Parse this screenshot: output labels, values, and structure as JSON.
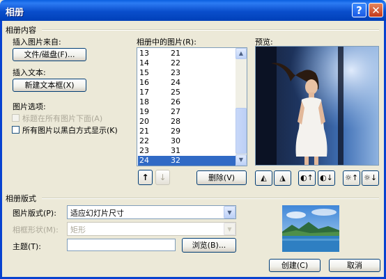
{
  "window": {
    "title": "相册",
    "help_glyph": "?",
    "close_glyph": "✕"
  },
  "album_content": {
    "group_label": "相册内容",
    "insert_from_label": "插入图片来自:",
    "file_disk_button": "文件/磁盘(F)...",
    "insert_text_label": "插入文本:",
    "new_textbox_button": "新建文本框(X)",
    "picture_options_label": "图片选项:",
    "caption_below_label": "标题在所有图片下面(A)",
    "caption_below_checked": false,
    "caption_below_enabled": false,
    "all_bw_label": "所有图片以黑白方式显示(K)",
    "all_bw_checked": false,
    "all_bw_enabled": true
  },
  "pictures_list": {
    "label": "相册中的图片(R):",
    "rows": [
      {
        "col1": "13",
        "col2": "21"
      },
      {
        "col1": "14",
        "col2": "22"
      },
      {
        "col1": "15",
        "col2": "23"
      },
      {
        "col1": "16",
        "col2": "24"
      },
      {
        "col1": "17",
        "col2": "25"
      },
      {
        "col1": "18",
        "col2": "26"
      },
      {
        "col1": "19",
        "col2": "27"
      },
      {
        "col1": "20",
        "col2": "28"
      },
      {
        "col1": "21",
        "col2": "29"
      },
      {
        "col1": "22",
        "col2": "30"
      },
      {
        "col1": "23",
        "col2": "31"
      },
      {
        "col1": "24",
        "col2": "32"
      }
    ],
    "selected_index": 11,
    "move_up_glyph": "↑",
    "move_down_glyph": "↓",
    "delete_button": "删除(V)"
  },
  "preview": {
    "label": "预览:",
    "tools": [
      {
        "name": "rotate-left-icon",
        "glyph": "◭"
      },
      {
        "name": "rotate-right-icon",
        "glyph": "◮"
      },
      {
        "name": "contrast-up-icon",
        "glyph": "◐↑"
      },
      {
        "name": "contrast-down-icon",
        "glyph": "◐↓"
      },
      {
        "name": "brightness-up-icon",
        "glyph": "☼↑"
      },
      {
        "name": "brightness-down-icon",
        "glyph": "☼↓"
      }
    ]
  },
  "album_layout": {
    "group_label": "相册版式",
    "picture_layout_label": "图片版式(P):",
    "picture_layout_value": "适应幻灯片尺寸",
    "frame_shape_label": "相框形状(M):",
    "frame_shape_value": "矩形",
    "theme_label": "主题(T):",
    "theme_value": "",
    "browse_button": "浏览(B)..."
  },
  "footer": {
    "create_button": "创建(C)",
    "cancel_button": "取消"
  },
  "colors": {
    "titlebar": "#0A4ECC",
    "dialog_bg": "#ECE9D8",
    "selection": "#316AC5"
  }
}
